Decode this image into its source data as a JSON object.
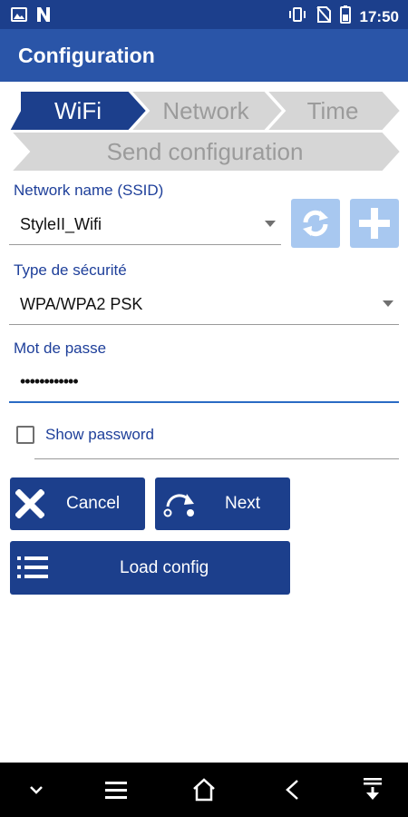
{
  "status_bar": {
    "time": "17:50"
  },
  "app_bar": {
    "title": "Configuration"
  },
  "stepper": {
    "steps": [
      {
        "label": "WiFi",
        "active": true
      },
      {
        "label": "Network",
        "active": false
      },
      {
        "label": "Time",
        "active": false
      },
      {
        "label": "Send configuration",
        "active": false
      }
    ]
  },
  "form": {
    "ssid": {
      "label": "Network name (SSID)",
      "value": "StyleII_Wifi"
    },
    "security": {
      "label": "Type de sécurité",
      "value": "WPA/WPA2 PSK"
    },
    "password": {
      "label": "Mot de passe",
      "value": "••••••••••••"
    },
    "show_password": {
      "label": "Show password",
      "checked": false
    }
  },
  "buttons": {
    "cancel": "Cancel",
    "next": "Next",
    "load_config": "Load config"
  },
  "colors": {
    "status_bar": "#1c3f8c",
    "app_bar": "#2a55a8",
    "primary_button": "#1c3f8c",
    "step_active": "#1c3f8c",
    "step_inactive": "#d6d6d6",
    "label_text": "#1e3f9a",
    "icon_button_disabled": "#a8c8f0"
  },
  "icons": {
    "status_left": [
      "image-icon",
      "n-notification-icon"
    ],
    "status_right": [
      "vibrate-icon",
      "no-sim-icon",
      "battery-icon"
    ],
    "ssid_actions": [
      "refresh-icon",
      "add-icon"
    ],
    "buttons": [
      "close-icon",
      "redo-icon",
      "list-icon"
    ],
    "nav": [
      "chevron-down-icon",
      "menu-icon",
      "home-icon",
      "back-icon",
      "download-icon"
    ]
  }
}
